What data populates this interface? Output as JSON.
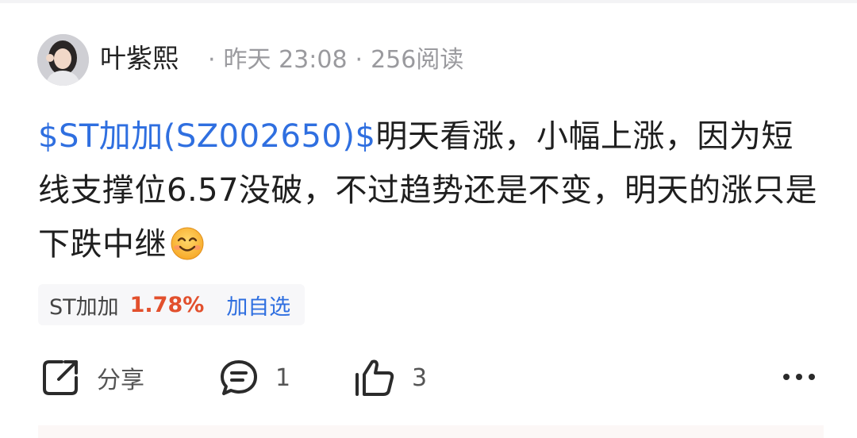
{
  "post": {
    "author": {
      "name": "叶紫熙",
      "avatar": "avatar-photo"
    },
    "time": "昨天 23:08",
    "separator": "·",
    "reads": "256阅读",
    "content": {
      "stock_tag": "$ST加加(SZ002650)$",
      "text": "明天看涨，小幅上涨，因为短线支撑位6.57没破，不过趋势还是不变，明天的涨只是下跌中继",
      "emoji": "smiling-face-emoji"
    },
    "stock_chip": {
      "name": "ST加加",
      "change": "1.78%",
      "add_label": "加自选"
    },
    "actions": {
      "share_label": "分享",
      "comment_count": "1",
      "like_count": "3"
    }
  },
  "colors": {
    "link": "#2f6fe0",
    "up": "#e2502d",
    "meta": "#9a9a9e"
  }
}
